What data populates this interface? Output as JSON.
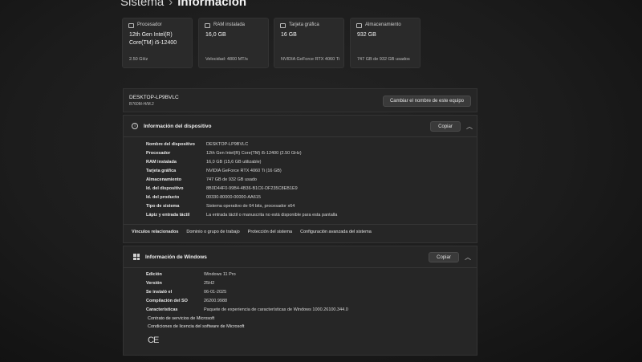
{
  "breadcrumb": {
    "parent": "Sistema",
    "current": "Información"
  },
  "cards": [
    {
      "label": "Procesador",
      "value": "12th Gen Intel(R) Core(TM) i5-12400",
      "sub": "2.50 GHz"
    },
    {
      "label": "RAM instalada",
      "value": "16,0 GB",
      "sub": "Velocidad: 4800 MT/s"
    },
    {
      "label": "Tarjeta gráfica",
      "value": "16 GB",
      "sub": "NVIDIA GeForce RTX 4060 Ti"
    },
    {
      "label": "Almacenamiento",
      "value": "932 GB",
      "sub": "747 GB de 932 GB usados"
    }
  ],
  "device": {
    "name": "DESKTOP-LP9BVLC",
    "model": "B760M-H/M.2",
    "rename_label": "Cambiar el nombre de este equipo"
  },
  "device_info": {
    "title": "Información del dispositivo",
    "copy_label": "Copiar",
    "specs": [
      {
        "k": "Nombre del dispositivo",
        "v": "DESKTOP-LP9BVLC"
      },
      {
        "k": "Procesador",
        "v": "12th Gen Intel(R) Core(TM) i5-12400 (2.50 GHz)"
      },
      {
        "k": "RAM instalada",
        "v": "16,0 GB (15,6 GB utilizable)"
      },
      {
        "k": "Tarjeta gráfica",
        "v": "NVIDIA GeForce RTX 4060 Ti (16 GB)"
      },
      {
        "k": "Almacenamiento",
        "v": "747 GB de 932 GB usado"
      },
      {
        "k": "Id. del dispositivo",
        "v": "8B0D44F0-99B4-4B36-B1C6-DF235C8EB1E9"
      },
      {
        "k": "Id. del producto",
        "v": "00330-80000-00000-AA615"
      },
      {
        "k": "Tipo de sistema",
        "v": "Sistema operativo de 64 bits, procesador x64"
      },
      {
        "k": "Lápiz y entrada táctil",
        "v": "La entrada táctil o manuscrita no está disponible para esta pantalla"
      }
    ],
    "related_label": "Vínculos relacionados",
    "related": [
      "Dominio o grupo de trabajo",
      "Protección del sistema",
      "Configuración avanzada del sistema"
    ]
  },
  "windows_info": {
    "title": "Información de Windows",
    "copy_label": "Copiar",
    "specs": [
      {
        "k": "Edición",
        "v": "Windows 11 Pro"
      },
      {
        "k": "Versión",
        "v": "25H2"
      },
      {
        "k": "Se instaló el",
        "v": "06-01-2025"
      },
      {
        "k": "Compilación del SO",
        "v": "26200.9988"
      },
      {
        "k": "Características",
        "v": "Paquete de experiencia de características de Windows 1000.26100.344.0"
      }
    ],
    "links": [
      "Contrato de servicios de Microsoft",
      "Condiciones de licencia del software de Microsoft"
    ],
    "ce_mark": "CE"
  },
  "icons": {
    "card": "chip-icon",
    "info": "info-icon",
    "windows": "windows-logo-icon",
    "collapse": "chevron-up-icon"
  }
}
